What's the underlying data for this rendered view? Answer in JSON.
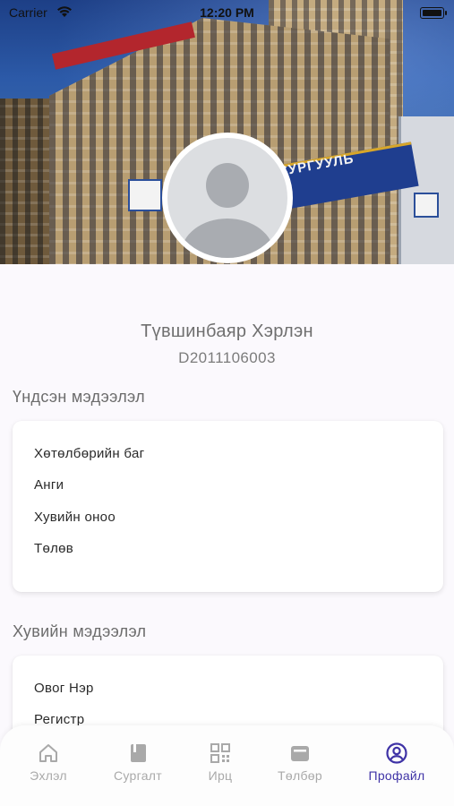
{
  "status_bar": {
    "carrier": "Carrier",
    "time": "12:20 PM",
    "wifi_icon": "wifi-icon",
    "battery_icon": "battery-icon"
  },
  "header": {
    "photo": "campus-building-photo",
    "sign_text": "СУРГУУЛЬ",
    "avatar_icon": "avatar-placeholder-icon"
  },
  "profile": {
    "name": "Түвшинбаяр Хэрлэн",
    "student_id": "D2011106003"
  },
  "basic_info": {
    "title": "Үндсэн мэдээлэл",
    "items": [
      {
        "label": "Хөтөлбөрийн баг"
      },
      {
        "label": "Анги"
      },
      {
        "label": "Хувийн оноо"
      },
      {
        "label": "Төлөв"
      }
    ]
  },
  "personal_info": {
    "title": "Хувийн мэдээлэл",
    "items": [
      {
        "label": "Овог Нэр"
      },
      {
        "label": "Регистр"
      }
    ]
  },
  "tab_bar": {
    "tabs": [
      {
        "label": "Эхлэл",
        "icon": "home-icon",
        "active": false
      },
      {
        "label": "Сургалт",
        "icon": "book-icon",
        "active": false
      },
      {
        "label": "Ирц",
        "icon": "qr-code-icon",
        "active": false
      },
      {
        "label": "Төлбөр",
        "icon": "wallet-icon",
        "active": false
      },
      {
        "label": "Профайл",
        "icon": "profile-icon",
        "active": true
      }
    ]
  },
  "colors": {
    "accent": "#3f33a6",
    "inactive": "#a9a9a9",
    "background": "#fbf9fd"
  }
}
